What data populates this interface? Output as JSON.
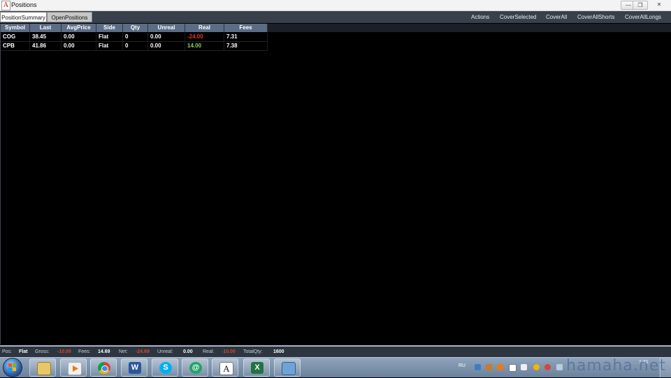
{
  "window": {
    "title": "Positions",
    "app_icon_glyph": "A"
  },
  "tabs": [
    {
      "label": "PositionSummary",
      "active": true
    },
    {
      "label": "OpenPositions",
      "active": false
    }
  ],
  "menu": [
    "Actions",
    "CoverSelected",
    "CoverAll",
    "CoverAllShorts",
    "CoverAllLongs"
  ],
  "grid": {
    "columns": [
      "Symbol",
      "Last",
      "AvgPrice",
      "Side",
      "Qty",
      "Unreal",
      "Real",
      "Fees"
    ],
    "rows": [
      {
        "symbol": "COG",
        "last": "38.45",
        "avg_price": "0.00",
        "side": "Flat",
        "qty": "0",
        "unreal": "0.00",
        "real": "-24.00",
        "fees": "7.31",
        "real_sign": "neg"
      },
      {
        "symbol": "CPB",
        "last": "41.86",
        "avg_price": "0.00",
        "side": "Flat",
        "qty": "0",
        "unreal": "0.00",
        "real": "14.00",
        "fees": "7.38",
        "real_sign": "pos"
      }
    ]
  },
  "status": {
    "pos_label": "Pos:",
    "pos_value": "Flat",
    "gross_label": "Gross:",
    "gross_value": "-10.00",
    "fees_label": "Fees:",
    "fees_value": "14.69",
    "net_label": "Net:",
    "net_value": "-24.69",
    "unreal_label": "Unreal:",
    "unreal_value": "0.00",
    "real_label": "Real:",
    "real_value": "-10.00",
    "totalqty_label": "TotalQty:",
    "totalqty_value": "1600"
  },
  "taskbar": {
    "items": [
      "explorer-icon",
      "media-player-icon",
      "chrome-icon",
      "word-icon",
      "skype-icon",
      "at-sign-app-icon",
      "trading-app-icon",
      "excel-icon",
      "generic-app-icon"
    ],
    "language": "RU",
    "clock_time": "1:31"
  },
  "watermark": "hamaha.net",
  "colors": {
    "negative": "#e2381a",
    "positive": "#8ed05a",
    "header_bg": "#5b6c84"
  }
}
